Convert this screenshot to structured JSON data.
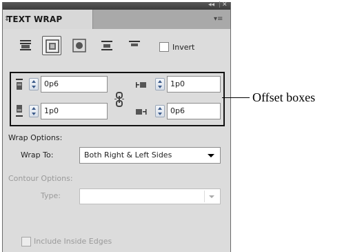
{
  "panel": {
    "title": "TEXT WRAP",
    "collapse_glyph": "◂◂",
    "close_glyph": "✕",
    "menu_glyph": "▾≡",
    "tab_arrows_glyph": "⇕"
  },
  "wrap_modes": [
    {
      "name": "no-text-wrap",
      "active": false
    },
    {
      "name": "wrap-around-bounding-box",
      "active": true
    },
    {
      "name": "wrap-around-object-shape",
      "active": false
    },
    {
      "name": "jump-object",
      "active": false
    },
    {
      "name": "jump-to-next-column",
      "active": false
    }
  ],
  "invert": {
    "label": "Invert",
    "checked": false
  },
  "offsets": {
    "top": "0p6",
    "bottom": "1p0",
    "left": "1p0",
    "right": "0p6",
    "linked": true
  },
  "wrap_options": {
    "heading": "Wrap Options:",
    "wrap_to_label": "Wrap To:",
    "wrap_to_value": "Both Right & Left Sides"
  },
  "contour_options": {
    "heading": "Contour Options:",
    "type_label": "Type:",
    "type_value": ""
  },
  "include_inside_edges": {
    "label": "Include Inside Edges",
    "checked": false
  },
  "callout": {
    "text": "Offset boxes"
  },
  "colors": {
    "panel_bg": "#dcdcdc",
    "titlebar": "#4a4a4a",
    "highlight_border": "#111111"
  }
}
